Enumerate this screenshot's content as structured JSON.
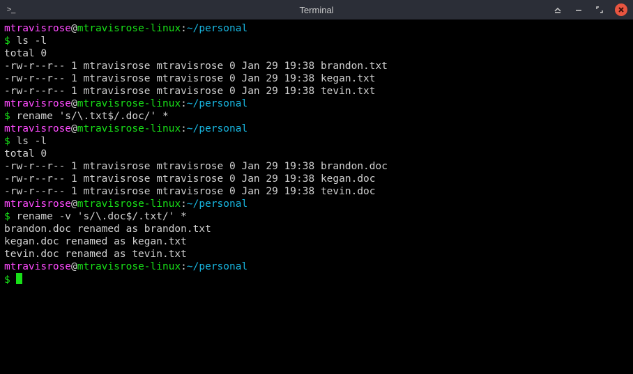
{
  "window": {
    "title": "Terminal",
    "app_icon": ">_"
  },
  "prompt": {
    "user": "mtravisrose",
    "host": "mtravisrose-linux",
    "path": "~/personal",
    "symbol": "$"
  },
  "session": [
    {
      "type": "prompt"
    },
    {
      "type": "command",
      "text": "ls -l"
    },
    {
      "type": "output",
      "text": "total 0"
    },
    {
      "type": "output",
      "text": "-rw-r--r-- 1 mtravisrose mtravisrose 0 Jan 29 19:38 brandon.txt"
    },
    {
      "type": "output",
      "text": "-rw-r--r-- 1 mtravisrose mtravisrose 0 Jan 29 19:38 kegan.txt"
    },
    {
      "type": "output",
      "text": "-rw-r--r-- 1 mtravisrose mtravisrose 0 Jan 29 19:38 tevin.txt"
    },
    {
      "type": "prompt"
    },
    {
      "type": "command",
      "text": "rename 's/\\.txt$/.doc/' *"
    },
    {
      "type": "prompt"
    },
    {
      "type": "command",
      "text": "ls -l"
    },
    {
      "type": "output",
      "text": "total 0"
    },
    {
      "type": "output",
      "text": "-rw-r--r-- 1 mtravisrose mtravisrose 0 Jan 29 19:38 brandon.doc"
    },
    {
      "type": "output",
      "text": "-rw-r--r-- 1 mtravisrose mtravisrose 0 Jan 29 19:38 kegan.doc"
    },
    {
      "type": "output",
      "text": "-rw-r--r-- 1 mtravisrose mtravisrose 0 Jan 29 19:38 tevin.doc"
    },
    {
      "type": "prompt"
    },
    {
      "type": "command",
      "text": "rename -v 's/\\.doc$/.txt/' *"
    },
    {
      "type": "output",
      "text": "brandon.doc renamed as brandon.txt"
    },
    {
      "type": "output",
      "text": "kegan.doc renamed as kegan.txt"
    },
    {
      "type": "output",
      "text": "tevin.doc renamed as tevin.txt"
    },
    {
      "type": "prompt"
    },
    {
      "type": "cursor"
    }
  ]
}
